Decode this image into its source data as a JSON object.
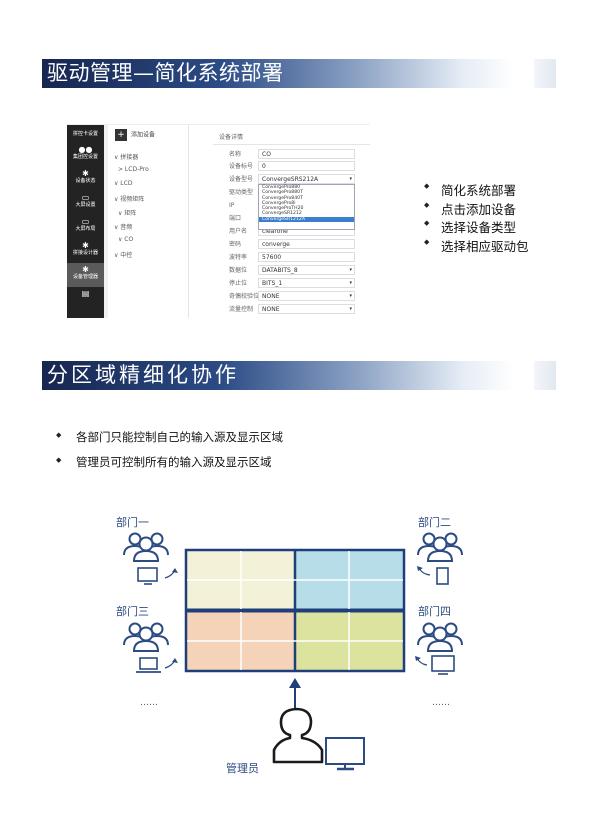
{
  "section1": {
    "title": "驱动管理—简化系统部署",
    "bullets": [
      "简化系统部署",
      "点击添加设备",
      "选择设备类型",
      "选择相应驱动包"
    ]
  },
  "app": {
    "sidebar": {
      "title": "拼控卡设置",
      "items": [
        {
          "icon": "users-icon",
          "label": "集团控设置"
        },
        {
          "icon": "gear-icon",
          "label": "设备状态"
        },
        {
          "icon": "display-icon",
          "label": "大屏设置"
        },
        {
          "icon": "display-icon",
          "label": "大屏布局"
        },
        {
          "icon": "gear-icon",
          "label": "拼接设计器"
        },
        {
          "icon": "gear-icon",
          "label": "设备管理器"
        }
      ]
    },
    "tree": {
      "add_label": "添加设备",
      "items": [
        "∨ 拼接器",
        "> LCD-Pro",
        "∨ LCD",
        "∨ 视频矩阵",
        "∨ 矩阵",
        "∨ 音频",
        "∨ CO",
        "∨ 中控"
      ]
    },
    "form": {
      "header": "设备详情",
      "fields": [
        {
          "label": "名称",
          "value": "CO"
        },
        {
          "label": "设备标号",
          "value": "0"
        },
        {
          "label": "设备型号",
          "value": "ConvergeSRS212A",
          "dropdown": true
        },
        {
          "label": "驱动类型",
          "value": ""
        },
        {
          "label": "IP",
          "value": ""
        },
        {
          "label": "端口",
          "value": ""
        },
        {
          "label": "用户名",
          "value": "clearone"
        },
        {
          "label": "密码",
          "value": "converge"
        },
        {
          "label": "波特率",
          "value": "57600"
        },
        {
          "label": "数据位",
          "value": "DATABITS_8",
          "dropdown": true
        },
        {
          "label": "停止位",
          "value": "BITS_1",
          "dropdown": true
        },
        {
          "label": "奇偶校验位",
          "value": "NONE",
          "dropdown": true
        },
        {
          "label": "流量控制",
          "value": "NONE",
          "dropdown": true
        }
      ],
      "dropdown_options": [
        "ConvergePro880",
        "ConvergePro880T",
        "ConvergePro840T",
        "ConvergePro8i",
        "ConvergeProTH20",
        "ConvergeSR1212",
        "ConvergeSR1212A"
      ],
      "dropdown_selected": "ConvergeSR1212A"
    }
  },
  "section2": {
    "title": "分区域精细化协作",
    "bullets": [
      "各部门只能控制自己的输入源及显示区域",
      "管理员可控制所有的输入源及显示区域"
    ]
  },
  "diagram": {
    "departments": [
      "部门一",
      "部门二",
      "部门三",
      "部门四"
    ],
    "admin_label": "管理员",
    "ellipsis_left": "……",
    "ellipsis_right": "……",
    "colors": {
      "accent": "#2c4b82",
      "q1": "#f3f2d8",
      "q2": "#b7dde9",
      "q3": "#f4d3b8",
      "q4": "#dbe39f",
      "grid_line": "#1e3f7a"
    }
  }
}
